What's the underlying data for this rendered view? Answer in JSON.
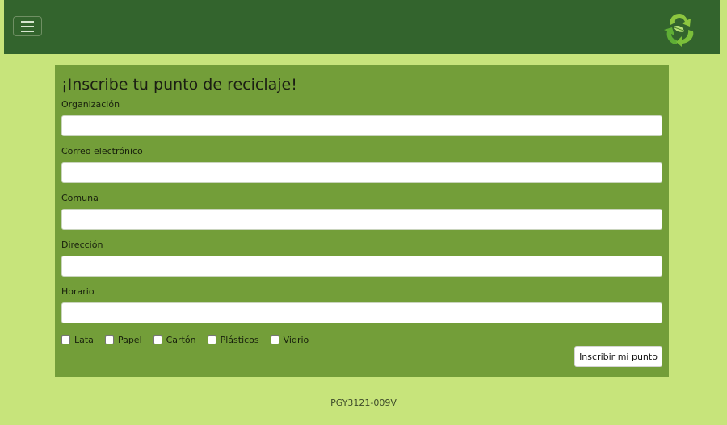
{
  "navbar": {
    "toggler_icon": "hamburger-menu-icon",
    "logo_icon": "recycle-leaf-logo-icon",
    "background_color": "#33642d"
  },
  "form": {
    "title": "¡Inscribe tu punto de reciclaje!",
    "fields": [
      {
        "label": "Organización",
        "value": "",
        "placeholder": ""
      },
      {
        "label": "Correo electrónico",
        "value": "",
        "placeholder": ""
      },
      {
        "label": "Comuna",
        "value": "",
        "placeholder": ""
      },
      {
        "label": "Dirección",
        "value": "",
        "placeholder": ""
      },
      {
        "label": "Horario",
        "value": "",
        "placeholder": ""
      }
    ],
    "materials": [
      {
        "label": "Lata",
        "checked": false
      },
      {
        "label": "Papel",
        "checked": false
      },
      {
        "label": "Cartón",
        "checked": false
      },
      {
        "label": "Plásticos",
        "checked": false
      },
      {
        "label": "Vidrio",
        "checked": false
      }
    ],
    "submit_label": "Inscribir mi punto",
    "background_color": "#739e39"
  },
  "footer": {
    "text": "PGY3121-009V"
  },
  "page_background_color": "#c7e47b"
}
